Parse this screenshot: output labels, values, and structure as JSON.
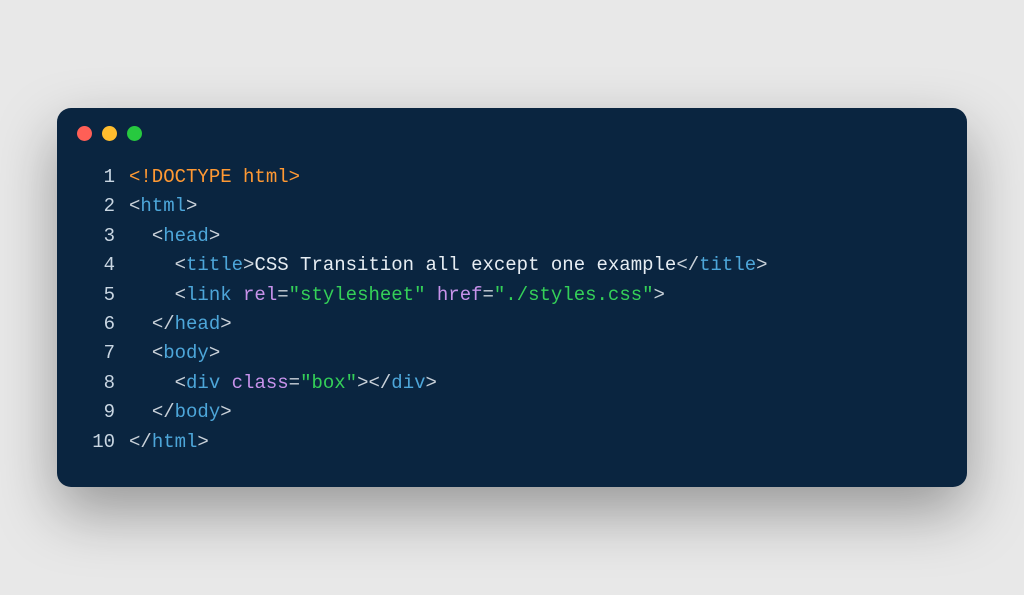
{
  "lineNumbers": [
    "1",
    "2",
    "3",
    "4",
    "5",
    "6",
    "7",
    "8",
    "9",
    "10"
  ],
  "lines": [
    [
      {
        "cls": "tok-doctype",
        "t": "<!DOCTYPE html>"
      }
    ],
    [
      {
        "cls": "tok-punct",
        "t": "<"
      },
      {
        "cls": "tok-tag",
        "t": "html"
      },
      {
        "cls": "tok-punct",
        "t": ">"
      }
    ],
    [
      {
        "cls": "tok-text",
        "t": "  "
      },
      {
        "cls": "tok-punct",
        "t": "<"
      },
      {
        "cls": "tok-tag",
        "t": "head"
      },
      {
        "cls": "tok-punct",
        "t": ">"
      }
    ],
    [
      {
        "cls": "tok-text",
        "t": "    "
      },
      {
        "cls": "tok-punct",
        "t": "<"
      },
      {
        "cls": "tok-tag",
        "t": "title"
      },
      {
        "cls": "tok-punct",
        "t": ">"
      },
      {
        "cls": "tok-text",
        "t": "CSS Transition all except one example"
      },
      {
        "cls": "tok-punct",
        "t": "</"
      },
      {
        "cls": "tok-tag",
        "t": "title"
      },
      {
        "cls": "tok-punct",
        "t": ">"
      }
    ],
    [
      {
        "cls": "tok-text",
        "t": "    "
      },
      {
        "cls": "tok-punct",
        "t": "<"
      },
      {
        "cls": "tok-tag",
        "t": "link"
      },
      {
        "cls": "tok-text",
        "t": " "
      },
      {
        "cls": "tok-attr",
        "t": "rel"
      },
      {
        "cls": "tok-punct",
        "t": "="
      },
      {
        "cls": "tok-string",
        "t": "\"stylesheet\""
      },
      {
        "cls": "tok-text",
        "t": " "
      },
      {
        "cls": "tok-attr",
        "t": "href"
      },
      {
        "cls": "tok-punct",
        "t": "="
      },
      {
        "cls": "tok-string",
        "t": "\"./styles.css\""
      },
      {
        "cls": "tok-punct",
        "t": ">"
      }
    ],
    [
      {
        "cls": "tok-text",
        "t": "  "
      },
      {
        "cls": "tok-punct",
        "t": "</"
      },
      {
        "cls": "tok-tag",
        "t": "head"
      },
      {
        "cls": "tok-punct",
        "t": ">"
      }
    ],
    [
      {
        "cls": "tok-text",
        "t": "  "
      },
      {
        "cls": "tok-punct",
        "t": "<"
      },
      {
        "cls": "tok-tag",
        "t": "body"
      },
      {
        "cls": "tok-punct",
        "t": ">"
      }
    ],
    [
      {
        "cls": "tok-text",
        "t": "    "
      },
      {
        "cls": "tok-punct",
        "t": "<"
      },
      {
        "cls": "tok-tag",
        "t": "div"
      },
      {
        "cls": "tok-text",
        "t": " "
      },
      {
        "cls": "tok-attr",
        "t": "class"
      },
      {
        "cls": "tok-punct",
        "t": "="
      },
      {
        "cls": "tok-string",
        "t": "\"box\""
      },
      {
        "cls": "tok-punct",
        "t": "></"
      },
      {
        "cls": "tok-tag",
        "t": "div"
      },
      {
        "cls": "tok-punct",
        "t": ">"
      }
    ],
    [
      {
        "cls": "tok-text",
        "t": "  "
      },
      {
        "cls": "tok-punct",
        "t": "</"
      },
      {
        "cls": "tok-tag",
        "t": "body"
      },
      {
        "cls": "tok-punct",
        "t": ">"
      }
    ],
    [
      {
        "cls": "tok-punct",
        "t": "</"
      },
      {
        "cls": "tok-tag",
        "t": "html"
      },
      {
        "cls": "tok-punct",
        "t": ">"
      }
    ]
  ]
}
